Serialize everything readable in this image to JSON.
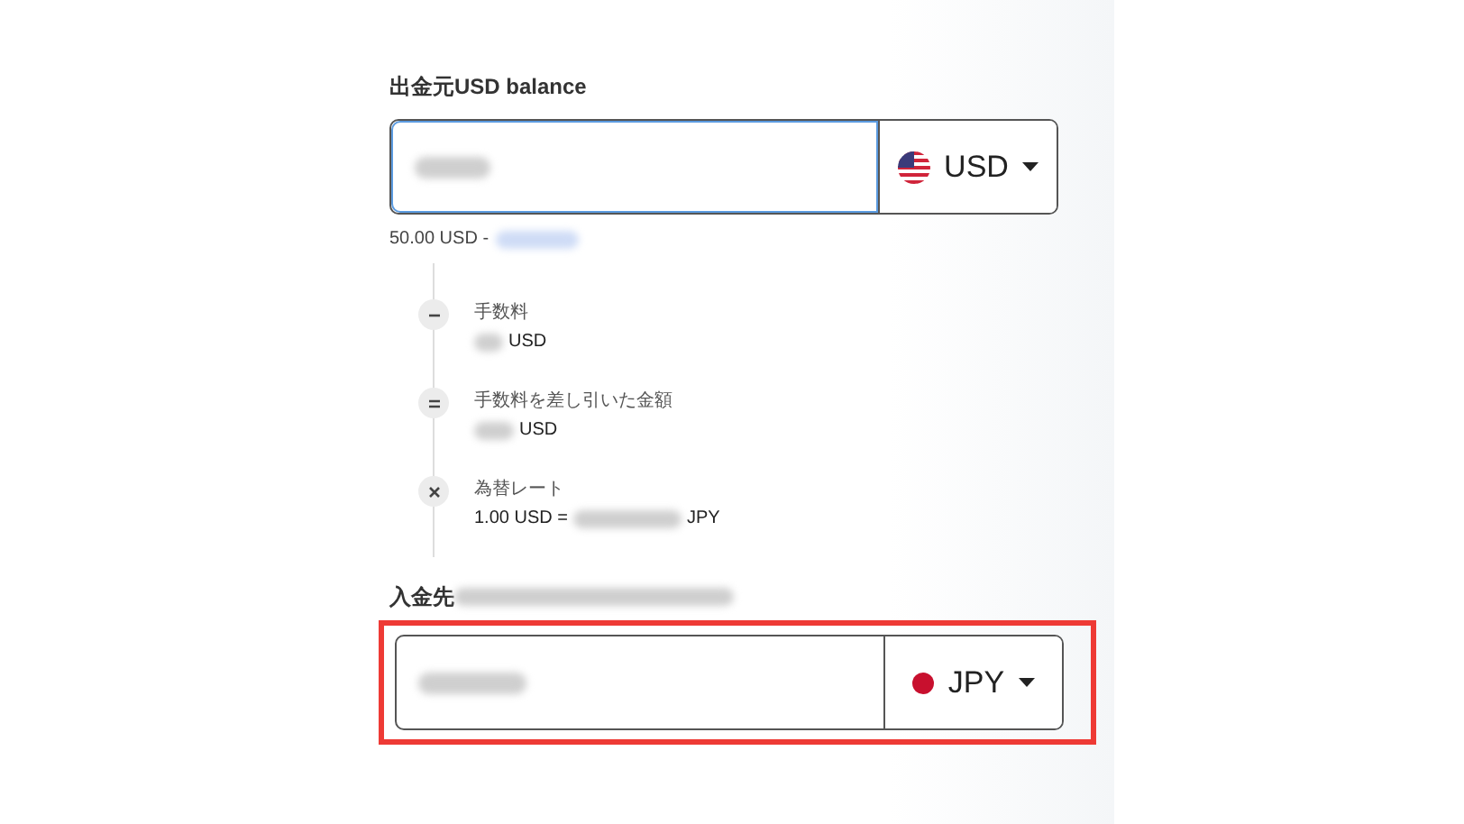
{
  "source": {
    "label": "出金元USD balance",
    "focused": true,
    "highlighted": false,
    "currency": {
      "code": "USD",
      "kind": "us"
    },
    "hint": "50.00 USD -"
  },
  "steps": [
    {
      "kind": "minus",
      "label": "手数料",
      "value_suffix": "USD"
    },
    {
      "kind": "equals",
      "label": "手数料を差し引いた金額",
      "value_suffix": "USD"
    },
    {
      "kind": "times",
      "label": "為替レート",
      "value_prefix": "1.00 USD =",
      "value_suffix": "JPY"
    }
  ],
  "destination": {
    "label": "入金先",
    "focused": false,
    "highlighted": true,
    "currency": {
      "code": "JPY",
      "kind": "jp"
    }
  }
}
